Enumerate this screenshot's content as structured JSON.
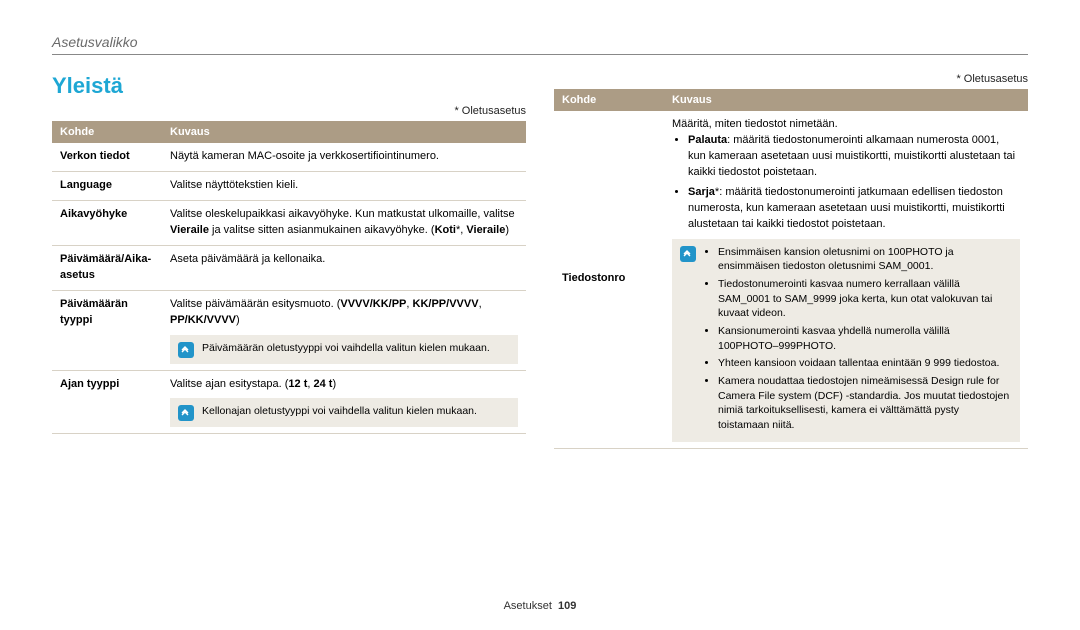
{
  "breadcrumb": "Asetusvalikko",
  "section_title": "Yleistä",
  "default_note": "* Oletusasetus",
  "table_headers": {
    "kohde": "Kohde",
    "kuvaus": "Kuvaus"
  },
  "left_table": [
    {
      "kohde": "Verkon tiedot",
      "kuvaus": "Näytä kameran MAC-osoite ja verkkosertifiointinumero."
    },
    {
      "kohde": "Language",
      "kuvaus": "Valitse näyttötekstien kieli."
    },
    {
      "kohde": "Aikavyöhyke",
      "kuvaus_html": "Valitse oleskelupaikkasi aikavyöhyke. Kun matkustat ulkomaille, valitse <b>Vieraile</b> ja valitse sitten asianmukainen aikavyöhyke. (<b>Koti</b>*, <b>Vieraile</b>)"
    },
    {
      "kohde": "Päivämäärä/Aika-asetus",
      "kuvaus": "Aseta päivämäärä ja kellonaika."
    },
    {
      "kohde": "Päivämäärän tyyppi",
      "kuvaus_html": "Valitse päivämäärän esitysmuoto. (<b>VVVV/KK/PP</b>, <b>KK/PP/VVVV</b>, <b>PP/KK/VVVV</b>)",
      "note": "Päivämäärän oletustyyppi voi vaihdella valitun kielen mukaan."
    },
    {
      "kohde": "Ajan tyyppi",
      "kuvaus_html": "Valitse ajan esitystapa. (<b>12 t</b>, <b>24 t</b>)",
      "note": "Kellonajan oletustyyppi voi vaihdella valitun kielen mukaan."
    }
  ],
  "right_table": {
    "kohde": "Tiedostonro",
    "intro": "Määritä, miten tiedostot nimetään.",
    "bullets": [
      "<b>Palauta</b>: määritä tiedostonumerointi alkamaan numerosta 0001, kun kameraan asetetaan uusi muistikortti, muistikortti alustetaan tai kaikki tiedostot poistetaan.",
      "<b>Sarja</b>*: määritä tiedostonumerointi jatkumaan edellisen tiedoston numerosta, kun kameraan asetetaan uusi muistikortti, muistikortti alustetaan tai kaikki tiedostot poistetaan."
    ],
    "note_bullets": [
      "Ensimmäisen kansion oletusnimi on 100PHOTO ja ensimmäisen tiedoston oletusnimi SAM_0001.",
      "Tiedostonumerointi kasvaa numero kerrallaan välillä SAM_0001 to SAM_9999 joka kerta, kun otat valokuvan tai kuvaat videon.",
      "Kansionumerointi kasvaa yhdellä numerolla välillä 100PHOTO–999PHOTO.",
      "Yhteen kansioon voidaan tallentaa enintään 9 999 tiedostoa.",
      "Kamera noudattaa tiedostojen nimeämisessä Design rule for Camera File system (DCF) -standardia. Jos muutat tiedostojen nimiä tarkoituksellisesti, kamera ei välttämättä pysty toistamaan niitä."
    ]
  },
  "footer": {
    "section": "Asetukset",
    "page": "109"
  }
}
